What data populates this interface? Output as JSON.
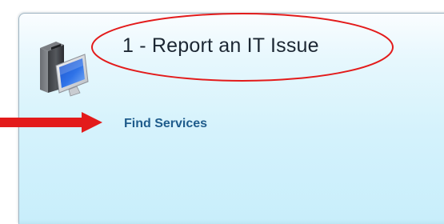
{
  "card": {
    "title": "1 - Report an IT Issue",
    "icon": "desktop-computer-icon",
    "link_label": "Find Services"
  },
  "annotations": {
    "ellipse_color": "#e31b1b",
    "arrow_color": "#e31b1b"
  },
  "colors": {
    "link": "#1f5c8c",
    "title": "#1c2733",
    "card_background_top": "#fafdff",
    "card_background_bottom": "#c8eefb"
  }
}
